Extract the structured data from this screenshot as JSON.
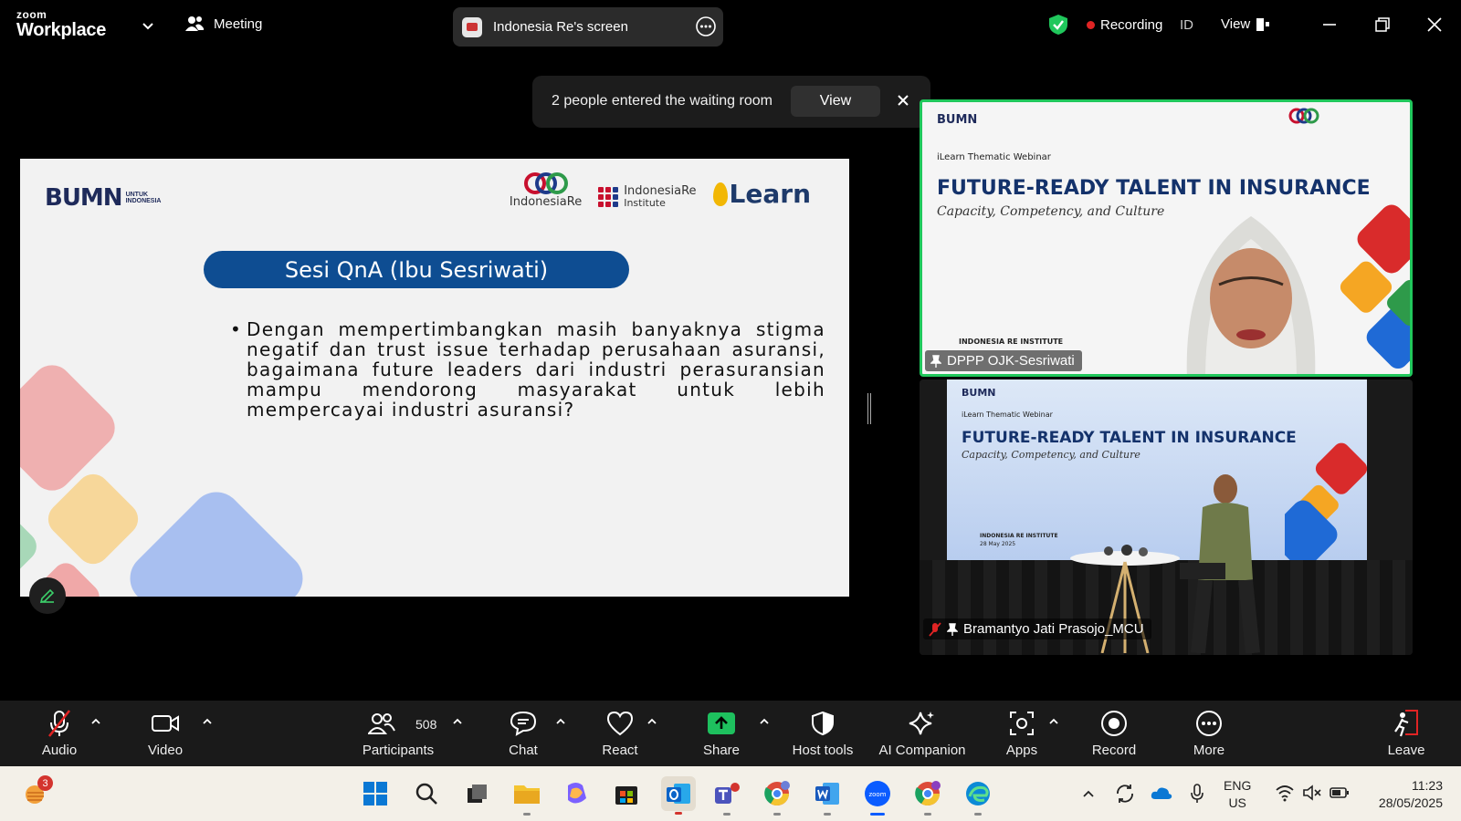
{
  "app": {
    "logo_line1": "zoom",
    "logo_line2": "Workplace"
  },
  "titlebar": {
    "meeting_label": "Meeting",
    "screen_share_label": "Indonesia Re's screen",
    "recording_label": "Recording",
    "id_label": "ID",
    "view_label": "View"
  },
  "notification": {
    "text": "2 people entered the waiting room",
    "view_button": "View"
  },
  "slide": {
    "bumn_logo": "BUMN",
    "bumn_sub_1": "UNTUK",
    "bumn_sub_2": "INDONESIA",
    "indonesiare_logo": "IndonesiaRe",
    "institute_logo_1": "IndonesiaRe",
    "institute_logo_2": "Institute",
    "ilearn_logo": "Learn",
    "qna_title": "Sesi QnA (Ibu Sesriwati)",
    "question": "Dengan mempertimbangkan masih banyaknya stigma negatif dan trust issue terhadap perusahaan asuransi, bagaimana future leaders dari industri perasuransian mampu mendorong masyarakat untuk lebih mempercayai industri asuransi?"
  },
  "tiles": [
    {
      "name": "DPPP OJK-Sesriwati",
      "webinar_label": "iLearn Thematic Webinar",
      "webinar_title": "FUTURE-READY TALENT IN INSURANCE",
      "webinar_sub": "Capacity, Competency, and Culture",
      "institute": "INDONESIA RE INSTITUTE",
      "bumn": "BUMN"
    },
    {
      "name": "Bramantyo Jati Prasojo_MCU",
      "webinar_label": "iLearn Thematic Webinar",
      "webinar_title": "FUTURE-READY TALENT IN INSURANCE",
      "webinar_sub": "Capacity, Competency, and Culture",
      "institute": "INDONESIA RE INSTITUTE",
      "date": "28 May 2025",
      "bumn": "BUMN"
    }
  ],
  "toolbar": {
    "audio": "Audio",
    "video": "Video",
    "participants": "Participants",
    "participants_count": "508",
    "chat": "Chat",
    "react": "React",
    "share": "Share",
    "host_tools": "Host tools",
    "ai_companion": "AI Companion",
    "apps": "Apps",
    "record": "Record",
    "more": "More",
    "leave": "Leave"
  },
  "taskbar": {
    "weather_badge": "3",
    "lang_1": "ENG",
    "lang_2": "US",
    "time": "11:23",
    "date": "28/05/2025"
  },
  "colors": {
    "accent_green": "#20c75c",
    "recording_red": "#e02424",
    "share_green": "#1ec05e",
    "qna_blue": "#0e4d92"
  }
}
